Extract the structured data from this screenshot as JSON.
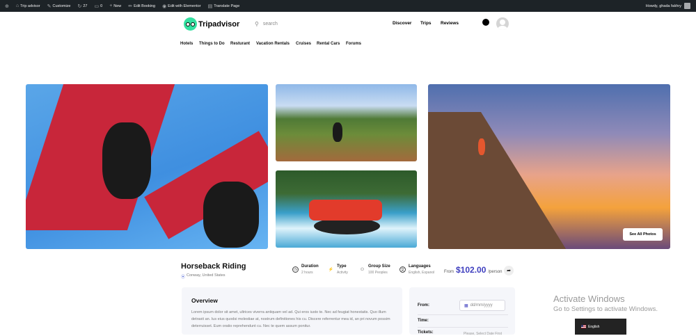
{
  "admin_bar": {
    "items": [
      {
        "icon": "wordpress-icon",
        "label": ""
      },
      {
        "icon": "home-icon",
        "label": "Trip advisor"
      },
      {
        "icon": "brush-icon",
        "label": "Customize"
      },
      {
        "icon": "refresh-icon",
        "label": "27"
      },
      {
        "icon": "comment-icon",
        "label": "0"
      },
      {
        "icon": "plus-icon",
        "label": "New"
      },
      {
        "icon": "pencil-icon",
        "label": "Edit Booking"
      },
      {
        "icon": "elementor-icon",
        "label": "Edit with Elementor"
      },
      {
        "icon": "translate-icon",
        "label": "Translate Page"
      }
    ],
    "greeting": "Howdy, ghada fakhry"
  },
  "header": {
    "logo_text": "Tripadvisor",
    "search_placeholder": "search",
    "nav": [
      "Discover",
      "Trips",
      "Reviews"
    ]
  },
  "categories": [
    "Hotels",
    "Things to Do",
    "Resturant",
    "Vacation Rentals",
    "Cruises",
    "Rental Cars",
    "Forums"
  ],
  "gallery": {
    "see_all_label": "See All Photos"
  },
  "tour": {
    "title": "Horseback Riding",
    "location": "Conway, United States",
    "meta": [
      {
        "icon": "clock-icon",
        "label": "Duration",
        "value": "2 hours"
      },
      {
        "icon": "activity-icon",
        "label": "Type",
        "value": "Activity"
      },
      {
        "icon": "group-icon",
        "label": "Group Size",
        "value": "100 Peoples"
      },
      {
        "icon": "language-icon",
        "label": "Languages",
        "value": "English, Espanol"
      }
    ],
    "price_from": "From",
    "price": "$102.00",
    "price_unit": "/person"
  },
  "overview": {
    "title": "Overview",
    "text": "Lorem ipsum dolor sit amet, ultrices viverra antiquam vel ad. Qui eros iusto te. Nec ad feugiat honestatis. Quo illum detraxit an. Ius eius quodsi molestiae at, nostrum definitiones his cu. Discere referrentur mea id, an pri novum possim deterruisset. Eum oratio reprehendunt cu. Nec te quem assum ponitur."
  },
  "booking": {
    "from_label": "From:",
    "date_placeholder": "dd/mm/yyyy",
    "time_label": "Time:",
    "tickets_label": "Tickets:",
    "tickets_hint": "Please, Select Date First"
  },
  "windows_watermark": {
    "line1": "Activate Windows",
    "line2": "Go to Settings to activate Windows."
  },
  "language_switcher": {
    "label": "English"
  }
}
